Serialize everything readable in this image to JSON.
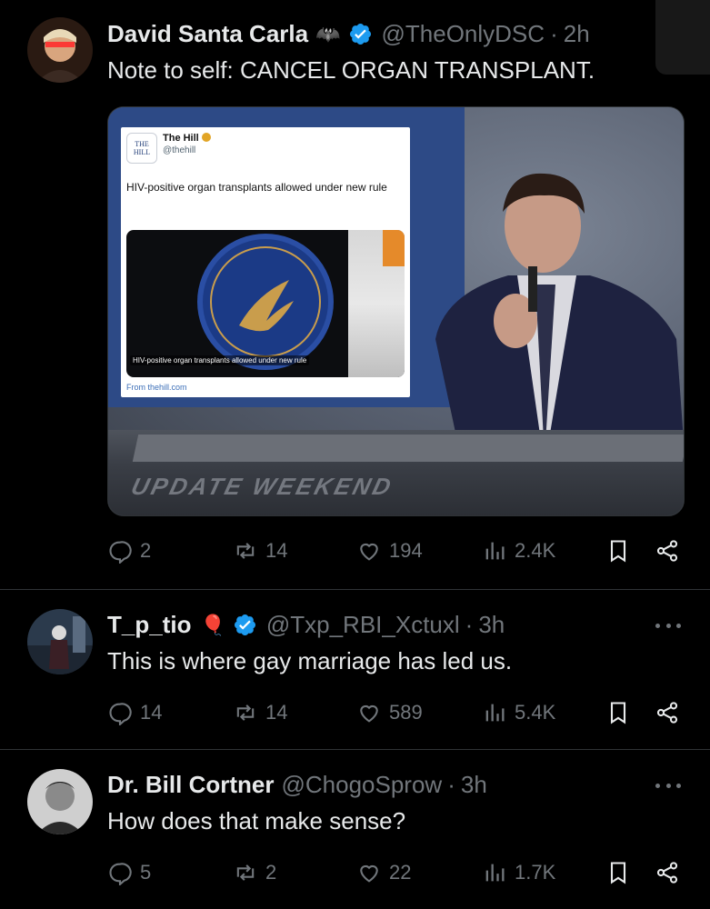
{
  "tweets": [
    {
      "name": "David Santa Carla",
      "name_emoji": "🦇",
      "handle": "@TheOnlyDSC",
      "dot": "·",
      "time": "2h",
      "text": "Note to self: CANCEL ORGAN TRANSPLANT.",
      "verified": true,
      "media": {
        "embed": {
          "logo": "THE HILL",
          "name": "The Hill",
          "handle": "@thehill",
          "text": "HIV-positive organ transplants allowed under new rule",
          "image_caption": "HIV-positive organ transplants allowed under new rule",
          "from": "From thehill.com"
        },
        "desk_text": "UPDATE WEEKEND"
      },
      "stats": {
        "replies": "2",
        "reposts": "14",
        "likes": "194",
        "views": "2.4K"
      }
    },
    {
      "name": "T_p_tio",
      "name_emoji": "🎈",
      "handle": "@Txp_RBI_Xctuxl",
      "dot": "·",
      "time": "3h",
      "text": "This is where gay marriage has led us.",
      "verified": true,
      "stats": {
        "replies": "14",
        "reposts": "14",
        "likes": "589",
        "views": "5.4K"
      }
    },
    {
      "name": "Dr. Bill Cortner",
      "handle": "@ChogoSprow",
      "dot": "·",
      "time": "3h",
      "text": "How does that make sense?",
      "verified": false,
      "stats": {
        "replies": "5",
        "reposts": "2",
        "likes": "22",
        "views": "1.7K"
      }
    }
  ],
  "icons": [
    "reply-icon",
    "repost-icon",
    "like-icon",
    "views-icon",
    "bookmark-icon",
    "share-icon",
    "more-icon",
    "verified-icon"
  ],
  "colors": {
    "background": "#000000",
    "text": "#e7e9ea",
    "muted": "#71767b",
    "verified": "#1d9bf0",
    "divider": "#2f3336"
  }
}
